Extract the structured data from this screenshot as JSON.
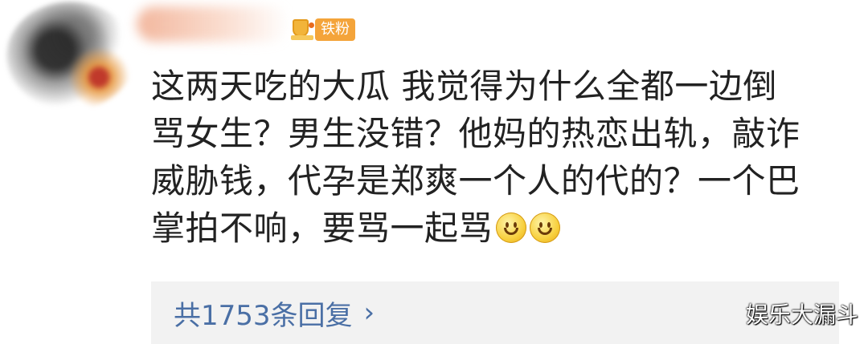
{
  "user": {
    "fan_badge_label": "铁粉"
  },
  "comment": {
    "lines": [
      "这两天吃的大瓜 我觉得为什么全都一边倒",
      "骂女生？男生没错？他妈的热恋出轨，敲诈",
      "威胁钱，代孕是郑爽一个人的代的？一个巴",
      "掌拍不响，要骂一起骂"
    ],
    "emoji": [
      "smile-emoji",
      "smile-emoji"
    ]
  },
  "replies": {
    "label": "共1753条回复",
    "chevron": "›"
  },
  "watermark": "娱乐大漏斗",
  "colors": {
    "text": "#222222",
    "link": "#4a6fa5",
    "replies_bg": "#f2f2f2",
    "badge": "#f4a43a"
  }
}
